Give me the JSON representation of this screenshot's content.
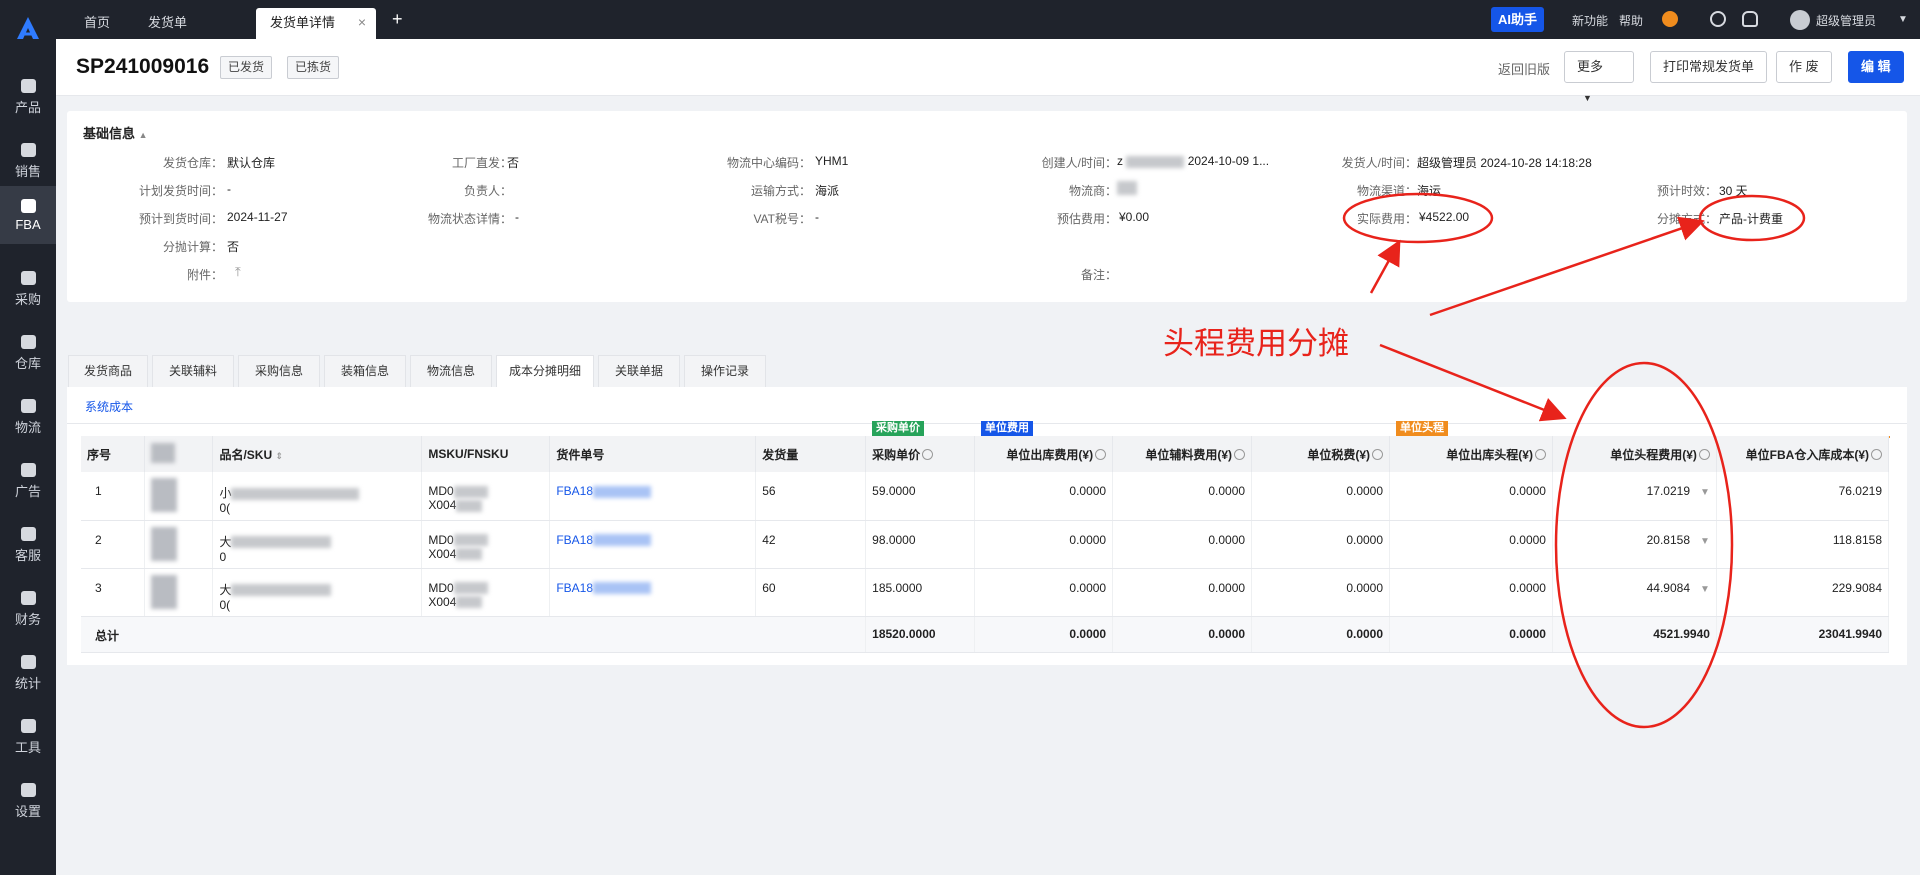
{
  "sidebar": {
    "items": [
      {
        "label": "产品"
      },
      {
        "label": "销售"
      },
      {
        "label": "FBA"
      },
      {
        "label": "采购"
      },
      {
        "label": "仓库"
      },
      {
        "label": "物流"
      },
      {
        "label": "广告"
      },
      {
        "label": "客服"
      },
      {
        "label": "财务"
      },
      {
        "label": "统计"
      },
      {
        "label": "工具"
      },
      {
        "label": "设置"
      }
    ]
  },
  "topbar": {
    "tabs": [
      {
        "label": "首页"
      },
      {
        "label": "发货单"
      },
      {
        "label": "发货单详情"
      }
    ],
    "close": "×",
    "add": "+",
    "ai": "AI助手",
    "new_feature": "新功能",
    "help": "帮助",
    "user": "超级管理员"
  },
  "header": {
    "doc_no": "SP241009016",
    "badges": [
      "已发货",
      "已拣货"
    ],
    "back_old": "返回旧版",
    "more": "更多",
    "print": "打印常规发货单",
    "void": "作 废",
    "edit": "编 辑"
  },
  "info": {
    "title": "基础信息",
    "fields": {
      "warehouse": {
        "label": "发货仓库：",
        "value": "默认仓库"
      },
      "direct": {
        "label": "工厂直发：",
        "value": "否"
      },
      "center": {
        "label": "物流中心编码：",
        "value": "YHM1"
      },
      "creator": {
        "label": "创建人/时间：",
        "prefix": "z",
        "value": "2024-10-09 1..."
      },
      "shipper": {
        "label": "发货人/时间：",
        "value": "超级管理员 2024-10-28 14:18:28"
      },
      "plan_date": {
        "label": "计划发货时间：",
        "value": "-"
      },
      "owner": {
        "label": "负责人：",
        "value": ""
      },
      "transport": {
        "label": "运输方式：",
        "value": "海派"
      },
      "carrier": {
        "label": "物流商：",
        "value": ""
      },
      "channel": {
        "label": "物流渠道：",
        "value": "海运"
      },
      "eta_days": {
        "label": "预计时效：",
        "value": "30 天"
      },
      "arrive_date": {
        "label": "预计到货时间：",
        "value": "2024-11-27"
      },
      "track": {
        "label": "物流状态详情：",
        "value": "-"
      },
      "vat": {
        "label": "VAT税号：",
        "value": "-"
      },
      "est_fee": {
        "label": "预估费用：",
        "value": "¥0.00"
      },
      "actual_fee": {
        "label": "实际费用：",
        "value": "¥4522.00"
      },
      "alloc_method": {
        "label": "分摊方式：",
        "value": "产品-计费重"
      },
      "alloc_calc": {
        "label": "分抛计算：",
        "value": "否"
      },
      "attachment": {
        "label": "附件：",
        "value": ""
      },
      "remark": {
        "label": "备注：",
        "value": ""
      }
    }
  },
  "detail_tabs": [
    "发货商品",
    "关联辅料",
    "采购信息",
    "装箱信息",
    "物流信息",
    "成本分摊明细",
    "关联单据",
    "操作记录"
  ],
  "subtab": "系统成本",
  "groups": {
    "purchase": {
      "label": "采购单价",
      "color": "#27a35a"
    },
    "unit_fee": {
      "label": "单位费用",
      "color": "#1556e8"
    },
    "unit_head": {
      "label": "单位头程",
      "color": "#f08c1e"
    }
  },
  "table": {
    "headers": [
      "序号",
      "",
      "品名/SKU",
      "MSKU/FNSKU",
      "货件单号",
      "发货量",
      "采购单价",
      "单位出库费用(¥)",
      "单位辅料费用(¥)",
      "单位税费(¥)",
      "单位出库头程(¥)",
      "单位头程费用(¥)",
      "单位FBA仓入库成本(¥)"
    ],
    "rows": [
      {
        "no": "1",
        "name": "小",
        "name2": "0(",
        "msku": "MD0",
        "fnsku": "X004",
        "shipment": "FBA18",
        "qty": "56",
        "price": "59.0000",
        "out_fee": "0.0000",
        "mat_fee": "0.0000",
        "tax": "0.0000",
        "out_head": "0.0000",
        "head_fee": "17.0219",
        "fba_cost": "76.0219"
      },
      {
        "no": "2",
        "name": "大",
        "name2": "0",
        "msku": "MD0",
        "fnsku": "X004",
        "shipment": "FBA18",
        "qty": "42",
        "price": "98.0000",
        "out_fee": "0.0000",
        "mat_fee": "0.0000",
        "tax": "0.0000",
        "out_head": "0.0000",
        "head_fee": "20.8158",
        "fba_cost": "118.8158"
      },
      {
        "no": "3",
        "name": "大",
        "name2": "0(",
        "msku": "MD0",
        "fnsku": "X004",
        "shipment": "FBA18",
        "qty": "60",
        "price": "185.0000",
        "out_fee": "0.0000",
        "mat_fee": "0.0000",
        "tax": "0.0000",
        "out_head": "0.0000",
        "head_fee": "44.9084",
        "fba_cost": "229.9084"
      }
    ],
    "total": {
      "label": "总计",
      "price": "18520.0000",
      "out_fee": "0.0000",
      "mat_fee": "0.0000",
      "tax": "0.0000",
      "out_head": "0.0000",
      "head_fee": "4521.9940",
      "fba_cost": "23041.9940"
    }
  },
  "annotation": {
    "text": "头程费用分摊",
    "color": "#e8231b"
  }
}
